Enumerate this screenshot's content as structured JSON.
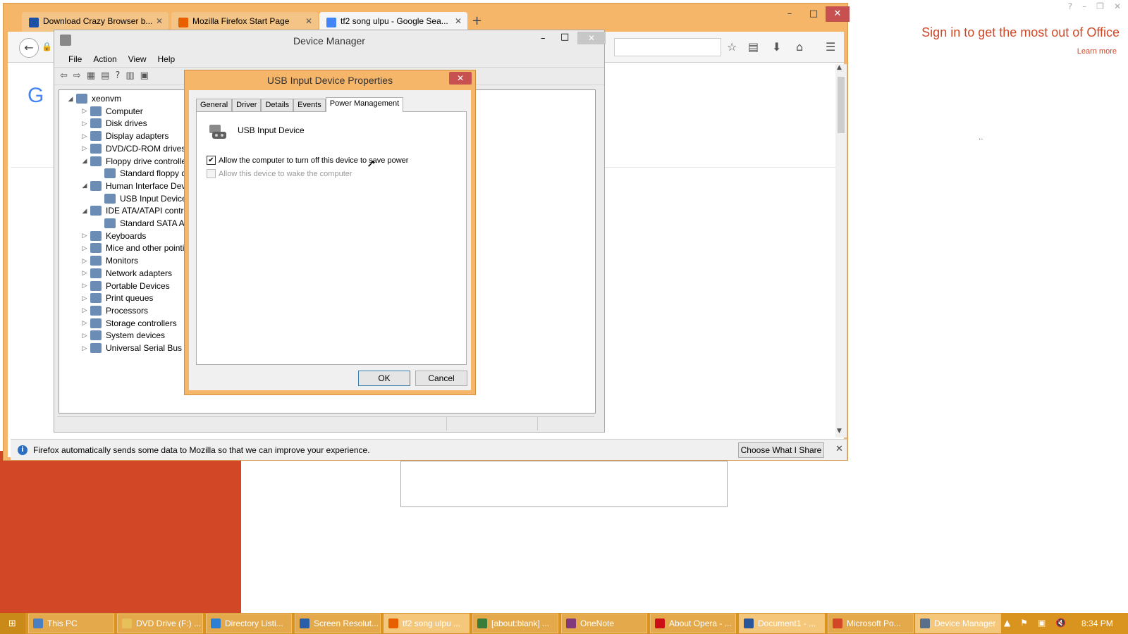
{
  "office": {
    "signin": "Sign in to get the most out of Office",
    "learn_more": "Learn more",
    "ctrls": [
      "?",
      "–",
      "❐",
      "✕"
    ],
    "dots": "‥"
  },
  "firefox": {
    "tabs": [
      {
        "label": "Download Crazy Browser b...",
        "icon_color": "#1d4fa6"
      },
      {
        "label": "Mozilla Firefox Start Page",
        "icon_color": "#e66000"
      },
      {
        "label": "tf2 song ulpu - Google Sea...",
        "icon_color": "#4285f4"
      }
    ],
    "tab_close": "✕",
    "new_tab": "+",
    "win_min": "–",
    "win_max": "□",
    "win_close": "✕",
    "google_letter": "G",
    "notification": {
      "text": "Firefox automatically sends some data to Mozilla so that we can improve your experience.",
      "button": "Choose What I Share",
      "close": "✕",
      "icon": "i"
    }
  },
  "device_manager": {
    "title": "Device Manager",
    "menu": [
      "File",
      "Action",
      "View",
      "Help"
    ],
    "tree": [
      {
        "label": "xeonvm",
        "level": 0,
        "expander": "◢"
      },
      {
        "label": "Computer",
        "level": 1,
        "expander": "▷"
      },
      {
        "label": "Disk drives",
        "level": 1,
        "expander": "▷"
      },
      {
        "label": "Display adapters",
        "level": 1,
        "expander": "▷"
      },
      {
        "label": "DVD/CD-ROM drives",
        "level": 1,
        "expander": "▷"
      },
      {
        "label": "Floppy drive controlle",
        "level": 1,
        "expander": "◢"
      },
      {
        "label": "Standard floppy d",
        "level": 2,
        "expander": ""
      },
      {
        "label": "Human Interface Devi",
        "level": 1,
        "expander": "◢"
      },
      {
        "label": "USB Input Device",
        "level": 2,
        "expander": ""
      },
      {
        "label": "IDE ATA/ATAPI contr",
        "level": 1,
        "expander": "◢"
      },
      {
        "label": "Standard SATA AH",
        "level": 2,
        "expander": ""
      },
      {
        "label": "Keyboards",
        "level": 1,
        "expander": "▷"
      },
      {
        "label": "Mice and other pointi",
        "level": 1,
        "expander": "▷"
      },
      {
        "label": "Monitors",
        "level": 1,
        "expander": "▷"
      },
      {
        "label": "Network adapters",
        "level": 1,
        "expander": "▷"
      },
      {
        "label": "Portable Devices",
        "level": 1,
        "expander": "▷"
      },
      {
        "label": "Print queues",
        "level": 1,
        "expander": "▷"
      },
      {
        "label": "Processors",
        "level": 1,
        "expander": "▷"
      },
      {
        "label": "Storage controllers",
        "level": 1,
        "expander": "▷"
      },
      {
        "label": "System devices",
        "level": 1,
        "expander": "▷"
      },
      {
        "label": "Universal Serial Bus cc",
        "level": 1,
        "expander": "▷"
      }
    ]
  },
  "dialog": {
    "title": "USB Input Device Properties",
    "tabs": [
      "General",
      "Driver",
      "Details",
      "Events",
      "Power Management"
    ],
    "active_tab": "Power Management",
    "device_name": "USB Input Device",
    "option1": {
      "label": "Allow the computer to turn off this device to save power",
      "checked": true
    },
    "option2": {
      "label": "Allow this device to wake the computer",
      "checked": false,
      "disabled": true
    },
    "ok": "OK",
    "cancel": "Cancel",
    "close": "✕"
  },
  "taskbar": {
    "items": [
      {
        "label": "This PC",
        "icon_color": "#4a7fc1"
      },
      {
        "label": "DVD Drive (F:) ...",
        "icon_color": "#e8c05a"
      },
      {
        "label": "Directory Listi...",
        "icon_color": "#2d7fd3"
      },
      {
        "label": "Screen Resolut...",
        "icon_color": "#2a5ea8"
      },
      {
        "label": "tf2 song ulpu ...",
        "icon_color": "#e66000",
        "active": true
      },
      {
        "label": "[about:blank] ...",
        "icon_color": "#3a7d3a"
      },
      {
        "label": "OneNote",
        "icon_color": "#80397b"
      },
      {
        "label": "About Opera - ...",
        "icon_color": "#cc0f16"
      },
      {
        "label": "Document1 - ...",
        "icon_color": "#2b579a",
        "active": true
      },
      {
        "label": "Microsoft Po...",
        "icon_color": "#d24726"
      },
      {
        "label": "Device Manager",
        "icon_color": "#5a6f8a",
        "active": true
      }
    ],
    "clock": "8:34 PM",
    "tray": [
      "▲",
      "⚑",
      "▣",
      "🔇"
    ]
  }
}
